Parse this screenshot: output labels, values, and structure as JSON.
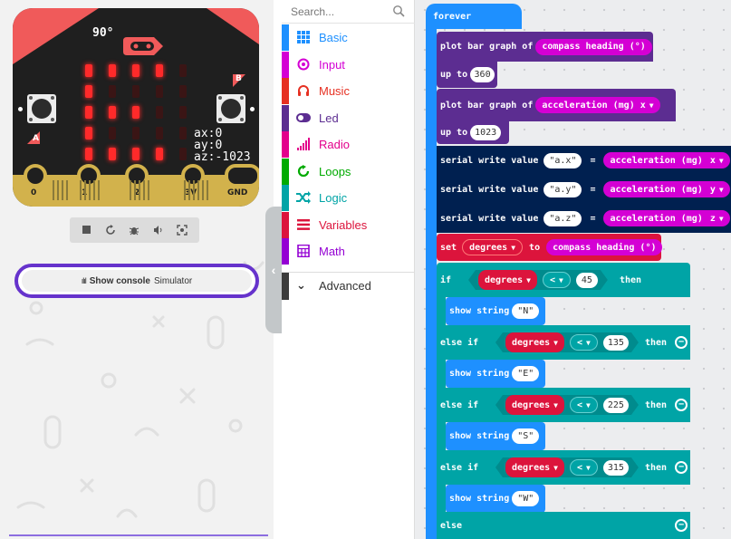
{
  "simulator": {
    "heading_display": "90°",
    "accel": {
      "ax": "ax:0",
      "ay": "ay:0",
      "az": "az:-1023"
    },
    "button_a": "A",
    "button_b": "B",
    "pins": [
      "0",
      "1",
      "2",
      "3V",
      "GND"
    ],
    "led_matrix": [
      [
        1,
        1,
        1,
        1,
        0
      ],
      [
        1,
        0,
        0,
        0,
        0
      ],
      [
        1,
        1,
        1,
        0,
        0
      ],
      [
        1,
        0,
        0,
        0,
        0
      ],
      [
        1,
        1,
        1,
        1,
        0
      ]
    ],
    "toolbar_icons": [
      "stop-icon",
      "restart-icon",
      "debug-icon",
      "mute-icon",
      "screenshot-icon"
    ],
    "console_button": {
      "label": "Show console",
      "sublabel": "Simulator"
    }
  },
  "toolbox": {
    "search_placeholder": "Search...",
    "categories": [
      {
        "label": "Basic",
        "color": "#1e90ff",
        "icon": "grid-icon"
      },
      {
        "label": "Input",
        "color": "#d400d4",
        "icon": "target-icon"
      },
      {
        "label": "Music",
        "color": "#e63022",
        "icon": "headphones-icon"
      },
      {
        "label": "Led",
        "color": "#5c2d91",
        "icon": "toggle-icon"
      },
      {
        "label": "Radio",
        "color": "#e3008c",
        "icon": "signal-icon"
      },
      {
        "label": "Loops",
        "color": "#00aa00",
        "icon": "loop-icon"
      },
      {
        "label": "Logic",
        "color": "#00a4a6",
        "icon": "shuffle-icon"
      },
      {
        "label": "Variables",
        "color": "#dc143c",
        "icon": "list-icon"
      },
      {
        "label": "Math",
        "color": "#9400d3",
        "icon": "calculator-icon"
      }
    ],
    "advanced_label": "Advanced"
  },
  "workspace": {
    "forever": "forever",
    "plot1": {
      "label": "plot bar graph of",
      "value": "compass heading (°)",
      "upto": "up to",
      "max": "360"
    },
    "plot2": {
      "label": "plot bar graph of",
      "value": "acceleration (mg)",
      "axis": "x",
      "upto": "up to",
      "max": "1023"
    },
    "serial": [
      {
        "label": "serial write value",
        "name": "\"a.x\"",
        "eq": "=",
        "value": "acceleration (mg)",
        "axis": "x"
      },
      {
        "label": "serial write value",
        "name": "\"a.y\"",
        "eq": "=",
        "value": "acceleration (mg)",
        "axis": "y"
      },
      {
        "label": "serial write value",
        "name": "\"a.z\"",
        "eq": "=",
        "value": "acceleration (mg)",
        "axis": "z"
      }
    ],
    "set_block": {
      "set": "set",
      "var": "degrees",
      "to": "to",
      "value": "compass heading (°)"
    },
    "conditions": [
      {
        "kw": "if",
        "var": "degrees",
        "op": "<",
        "num": "45",
        "then": "then",
        "show": "show string",
        "text": "\"N\""
      },
      {
        "kw": "else if",
        "var": "degrees",
        "op": "<",
        "num": "135",
        "then": "then",
        "show": "show string",
        "text": "\"E\""
      },
      {
        "kw": "else if",
        "var": "degrees",
        "op": "<",
        "num": "225",
        "then": "then",
        "show": "show string",
        "text": "\"S\""
      },
      {
        "kw": "else if",
        "var": "degrees",
        "op": "<",
        "num": "315",
        "then": "then",
        "show": "show string",
        "text": "\"W\""
      }
    ],
    "else_label": "else"
  }
}
